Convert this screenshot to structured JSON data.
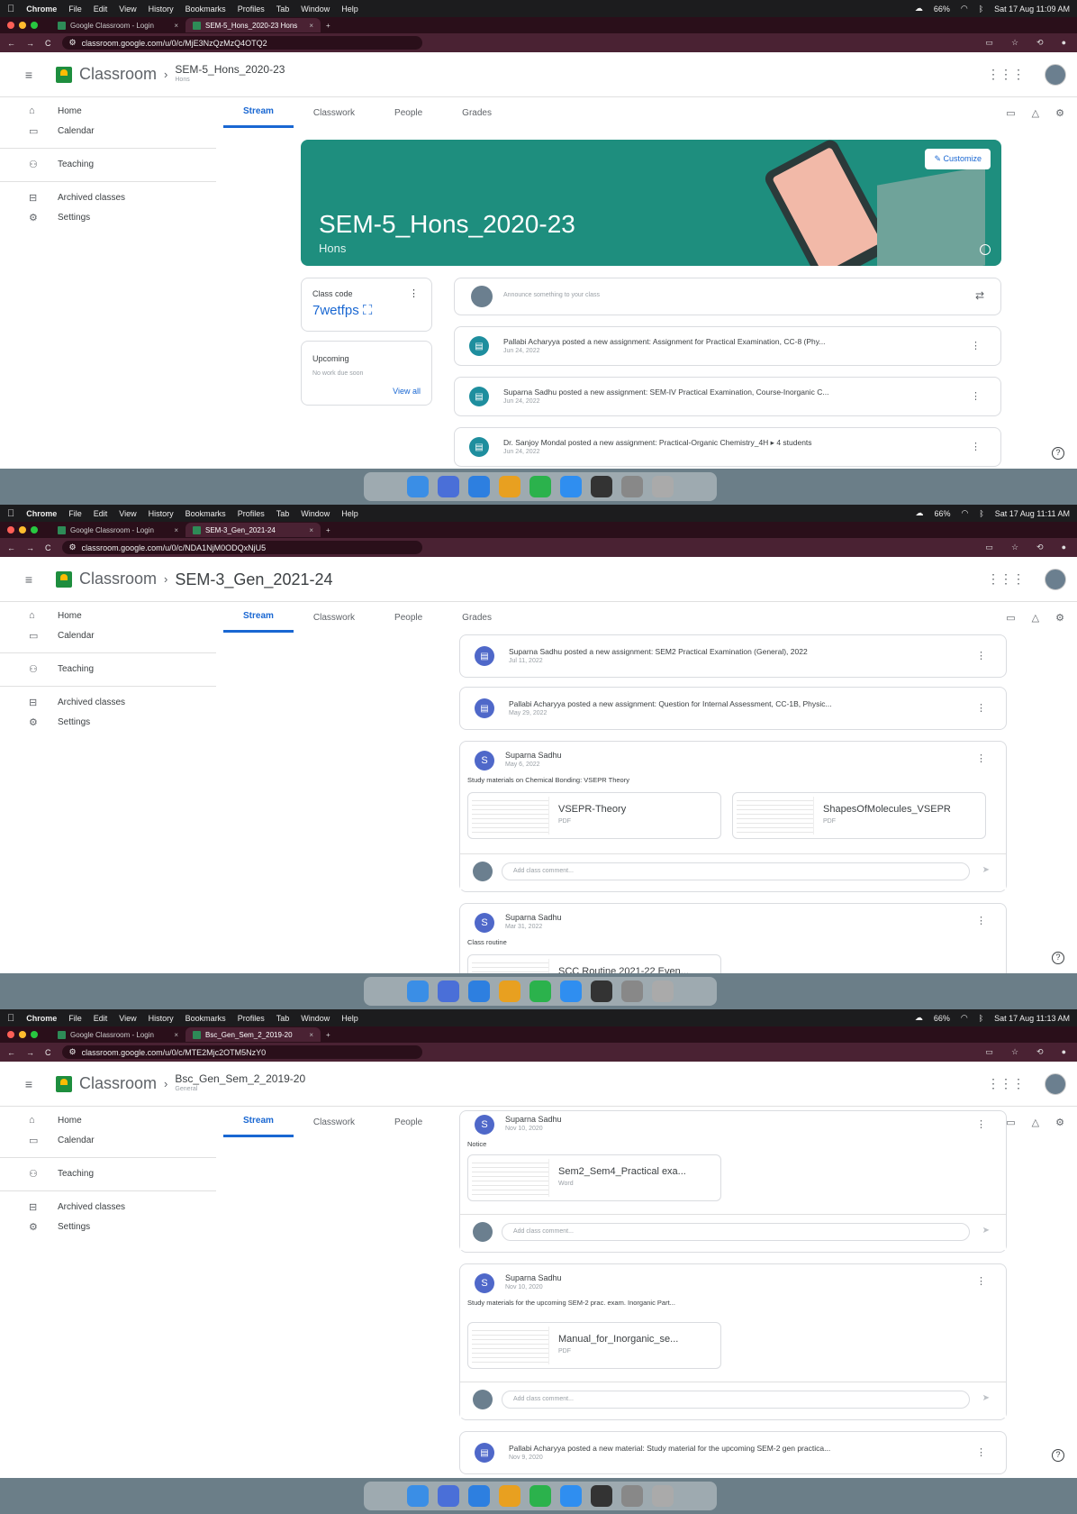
{
  "menubar": {
    "apple": "",
    "items": [
      "Chrome",
      "File",
      "Edit",
      "View",
      "History",
      "Bookmarks",
      "Profiles",
      "Tab",
      "Window",
      "Help"
    ],
    "battery": "66%"
  },
  "address": {
    "reload": "C"
  },
  "classroom": {
    "app_name": "Classroom"
  },
  "nav": {
    "items": [
      "Home",
      "Calendar",
      "Teaching",
      "Archived classes",
      "Settings"
    ]
  },
  "class_tabs": [
    "Stream",
    "Classwork",
    "People",
    "Grades"
  ],
  "screens": [
    {
      "tabs": [
        "Google Classroom - Login",
        "SEM-5_Hons_2020-23 Hons"
      ],
      "url": "classroom.google.com/u/0/c/MjE3NzQzMzQ4OTQ2",
      "clock": "Sat 17 Aug 11:09 AM",
      "class_title": "SEM-5_Hons_2020-23",
      "class_sub": "Hons",
      "banner": {
        "title": "SEM-5_Hons_2020-23",
        "sub": "Hons",
        "customize": "Customize"
      },
      "class_code": {
        "label": "Class code",
        "value": "7wetfps"
      },
      "upcoming": {
        "label": "Upcoming",
        "empty": "No work due soon",
        "view_all": "View all"
      },
      "announce_placeholder": "Announce something to your class",
      "posts": [
        {
          "title": "Pallabi Acharyya posted a new assignment: Assignment for Practical Examination, CC-8 (Phy...",
          "date": "Jun 24, 2022"
        },
        {
          "title": "Suparna Sadhu posted a new assignment: SEM-IV Practical Examination, Course-Inorganic C...",
          "date": "Jun 24, 2022"
        },
        {
          "title": "Dr. Sanjoy Mondal posted a new assignment: Practical-Organic Chemistry_4H ▸ 4 students",
          "date": "Jun 24, 2022"
        }
      ]
    },
    {
      "tabs": [
        "Google Classroom - Login",
        "SEM-3_Gen_2021-24"
      ],
      "url": "classroom.google.com/u/0/c/NDA1NjM0ODQxNjU5",
      "clock": "Sat 17 Aug 11:11 AM",
      "class_title": "SEM-3_Gen_2021-24",
      "posts": [
        {
          "title": "Suparna Sadhu posted a new assignment: SEM2 Practical Examination (General), 2022",
          "date": "Jul 11, 2022"
        },
        {
          "title": "Pallabi Acharyya posted a new assignment: Question for Internal Assessment, CC-1B, Physic...",
          "date": "May 29, 2022"
        }
      ],
      "materials": [
        {
          "author": "Suparna Sadhu",
          "date": "May 6, 2022",
          "body": "Study materials on Chemical Bonding: VSEPR Theory",
          "attachments": [
            {
              "name": "VSEPR-Theory",
              "kind": "PDF"
            },
            {
              "name": "ShapesOfMolecules_VSEPR",
              "kind": "PDF"
            }
          ]
        },
        {
          "author": "Suparna Sadhu",
          "date": "Mar 31, 2022",
          "body": "Class routine",
          "attachments": [
            {
              "name": "SCC Routine 2021-22 Even...",
              "kind": ""
            }
          ]
        }
      ],
      "comment_placeholder": "Add class comment..."
    },
    {
      "tabs": [
        "Google Classroom - Login",
        "Bsc_Gen_Sem_2_2019-20"
      ],
      "url": "classroom.google.com/u/0/c/MTE2Mjc2OTM5NzY0",
      "clock": "Sat 17 Aug 11:13 AM",
      "class_title": "Bsc_Gen_Sem_2_2019-20",
      "class_sub": "General",
      "materials": [
        {
          "author": "Suparna Sadhu",
          "date": "Nov 10, 2020",
          "body": "Notice",
          "attachments": [
            {
              "name": "Sem2_Sem4_Practical exa...",
              "kind": "Word"
            }
          ]
        },
        {
          "author": "Suparna Sadhu",
          "date": "Nov 10, 2020",
          "body": "Study materials for the upcoming SEM-2 prac. exam. Inorganic Part...",
          "attachments": [
            {
              "name": "Manual_for_Inorganic_se...",
              "kind": "PDF"
            }
          ]
        }
      ],
      "last_post": {
        "title": "Pallabi Acharyya posted a new material: Study material for the upcoming SEM-2 gen practica...",
        "date": "Nov 9, 2020"
      },
      "comment_placeholder": "Add class comment..."
    }
  ],
  "colors": {
    "accent": "#1967d2",
    "banner": "#1e8e7e",
    "tab_bg": "#4a2233",
    "avatar_s": "#4f68c9"
  }
}
